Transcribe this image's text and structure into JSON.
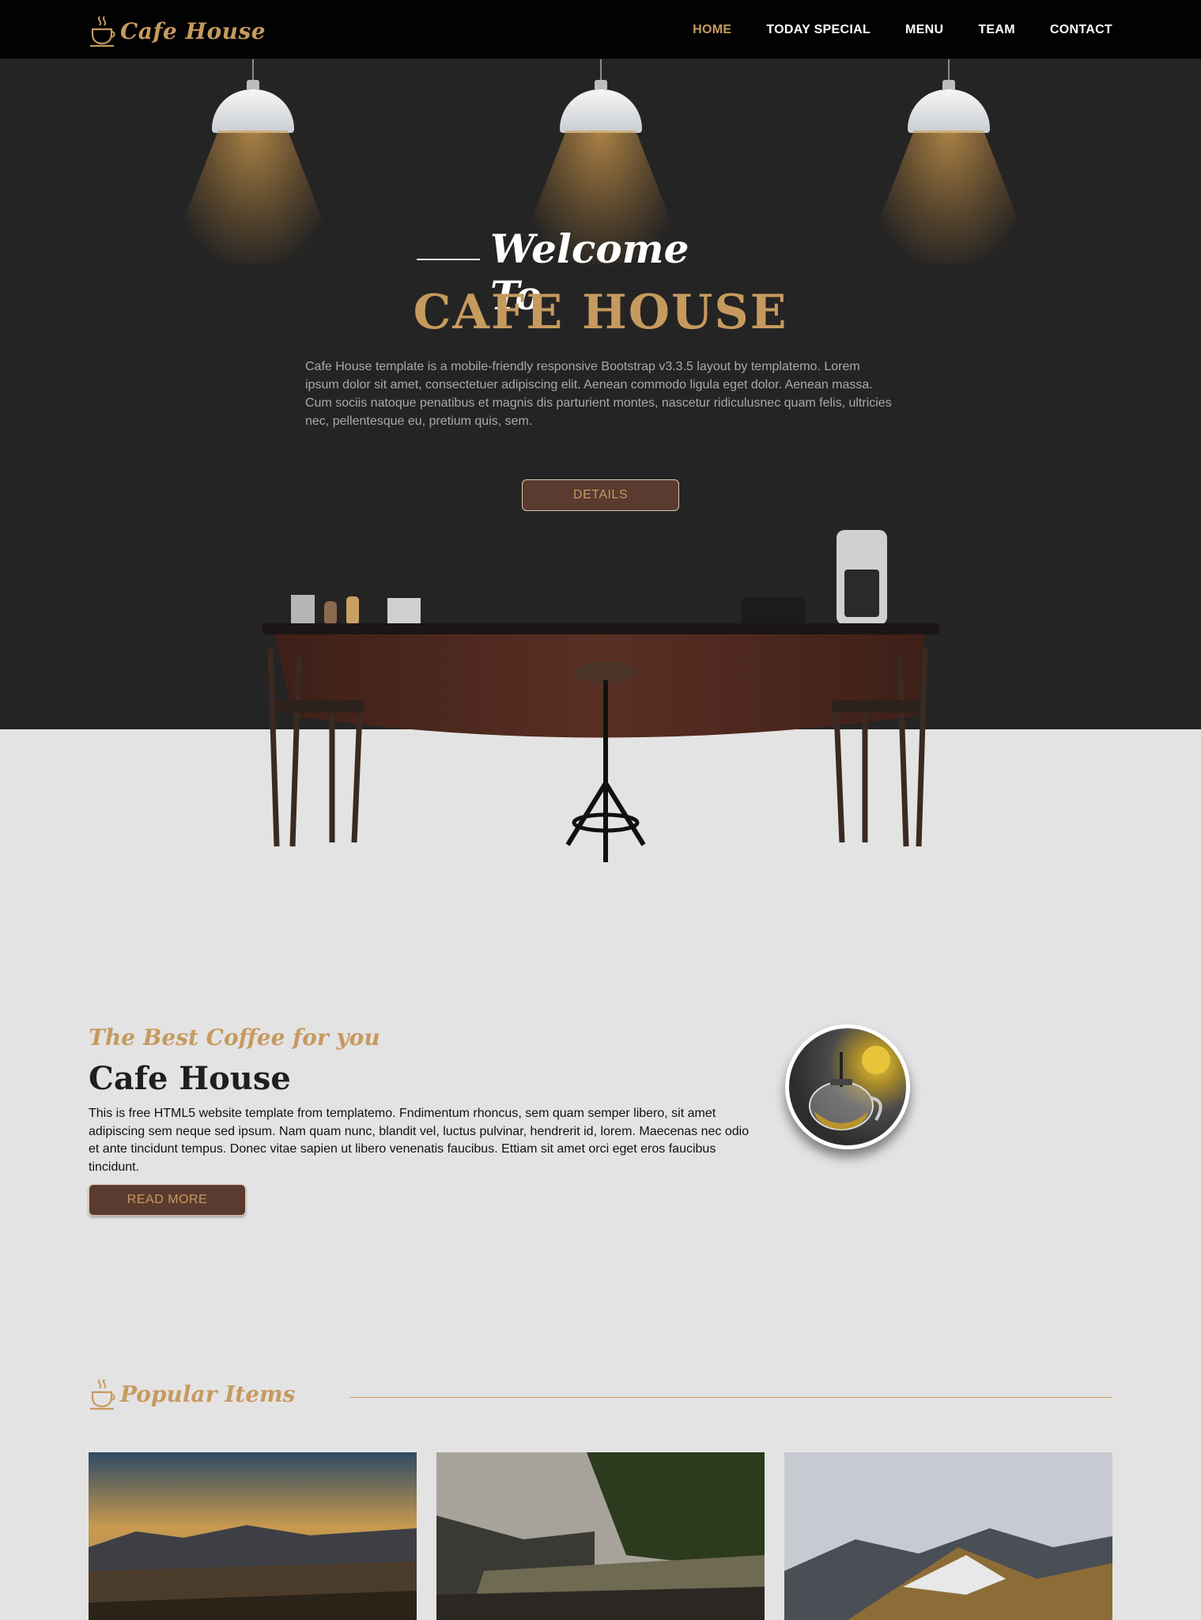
{
  "brand": {
    "name": "Cafe House"
  },
  "nav": {
    "items": [
      {
        "label": "HOME",
        "active": true
      },
      {
        "label": "TODAY SPECIAL",
        "active": false
      },
      {
        "label": "MENU",
        "active": false
      },
      {
        "label": "TEAM",
        "active": false
      },
      {
        "label": "CONTACT",
        "active": false
      }
    ]
  },
  "hero": {
    "welcome": "Welcome To",
    "title": "CAFE HOUSE",
    "description": "Cafe House template is a mobile-friendly responsive Bootstrap v3.3.5 layout by templatemo. Lorem ipsum dolor sit amet, consectetuer adipiscing elit. Aenean commodo ligula eget dolor. Aenean massa. Cum sociis natoque penatibus et magnis dis parturient montes, nascetur ridiculusnec quam felis, ultricies nec, pellentesque eu, pretium quis, sem.",
    "button_label": "DETAILS"
  },
  "about": {
    "script_title": "The Best Coffee for you",
    "title": "Cafe House",
    "text": "This is free HTML5 website template from templatemo. Fndimentum rhoncus, sem quam semper libero, sit amet adipiscing sem neque sed ipsum. Nam quam nunc, blandit vel, luctus pulvinar, hendrerit id, lorem. Maecenas nec odio et ante tincidunt tempus. Donec vitae sapien ut libero venenatis faucibus. Ettiam sit amet orci eget eros faucibus tincidunt.",
    "button_label": "READ MORE"
  },
  "popular": {
    "title": "Popular Items"
  },
  "colors": {
    "accent": "#c69a5e",
    "nav_bg": "#020202",
    "hero_bg": "#252424",
    "page_bg": "#e4e3e3",
    "button_bg": "#5b3a30"
  }
}
